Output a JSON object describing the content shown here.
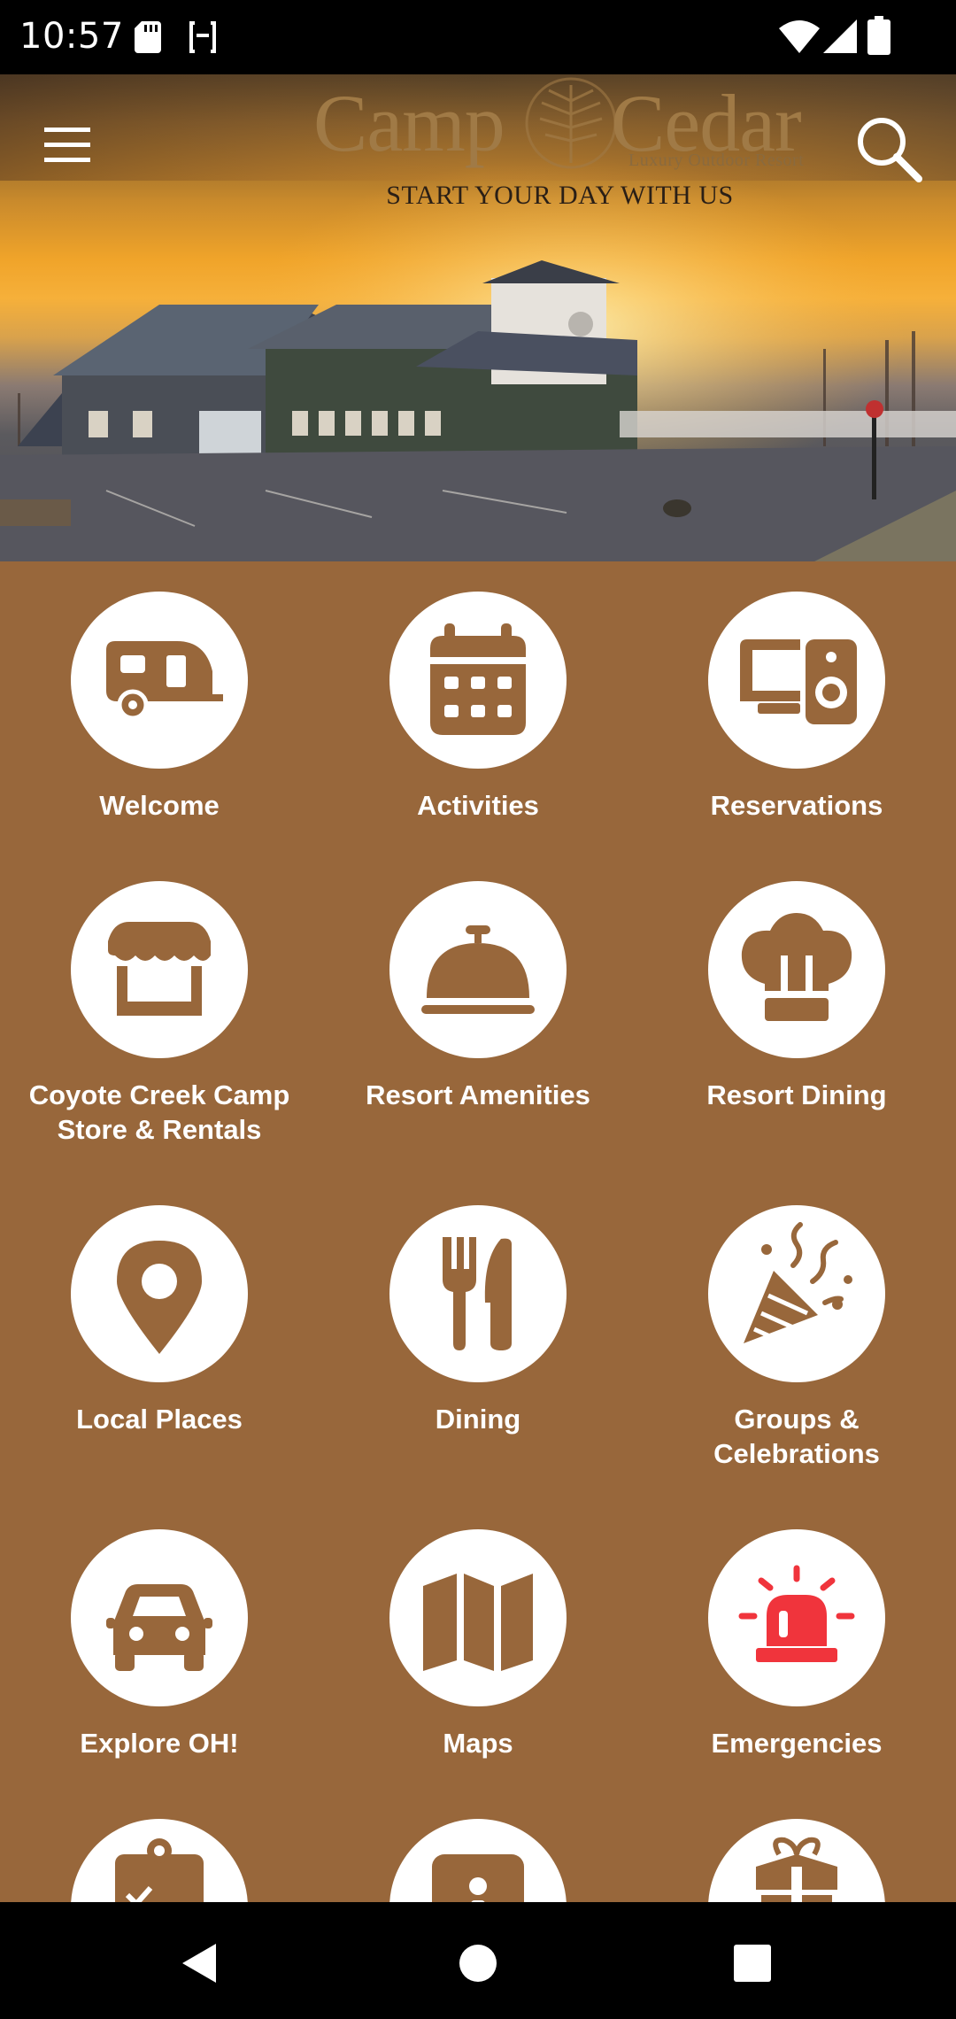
{
  "status_bar": {
    "time": "10:57",
    "icons": [
      "sd-card-icon",
      "face-icon",
      "wifi-icon",
      "signal-icon",
      "battery-icon"
    ]
  },
  "header": {
    "logo_part1": "Camp",
    "logo_part2": "Cedar",
    "logo_subtitle": "Luxury Outdoor Resort",
    "tagline": "START YOUR DAY WITH US",
    "menu_icon": "hamburger-menu-icon",
    "search_icon": "search-icon"
  },
  "tiles": [
    {
      "label": "Welcome",
      "icon": "camper-trailer-icon"
    },
    {
      "label": "Activities",
      "icon": "calendar-icon"
    },
    {
      "label": "Reservations",
      "icon": "devices-icon"
    },
    {
      "label": "Coyote Creek Camp\nStore & Rentals",
      "icon": "store-icon"
    },
    {
      "label": "Resort Amenities",
      "icon": "service-bell-icon"
    },
    {
      "label": "Resort Dining",
      "icon": "chef-hat-icon"
    },
    {
      "label": "Local Places",
      "icon": "map-pin-icon"
    },
    {
      "label": "Dining",
      "icon": "fork-knife-icon"
    },
    {
      "label": "Groups &\nCelebrations",
      "icon": "party-popper-icon"
    },
    {
      "label": "Explore OH!",
      "icon": "car-icon"
    },
    {
      "label": "Maps",
      "icon": "folded-map-icon"
    },
    {
      "label": "Emergencies",
      "icon": "siren-icon"
    }
  ],
  "partial_tiles_icons": [
    "clipboard-check-icon",
    "info-icon",
    "gift-icon"
  ],
  "colors": {
    "grid_background": "#98673b",
    "icon_color": "#98673b",
    "emergency_icon_color": "#f0343c",
    "circle_color": "#ffffff"
  },
  "nav_bar": {
    "icons": [
      "back-icon",
      "home-icon",
      "recents-icon"
    ]
  }
}
